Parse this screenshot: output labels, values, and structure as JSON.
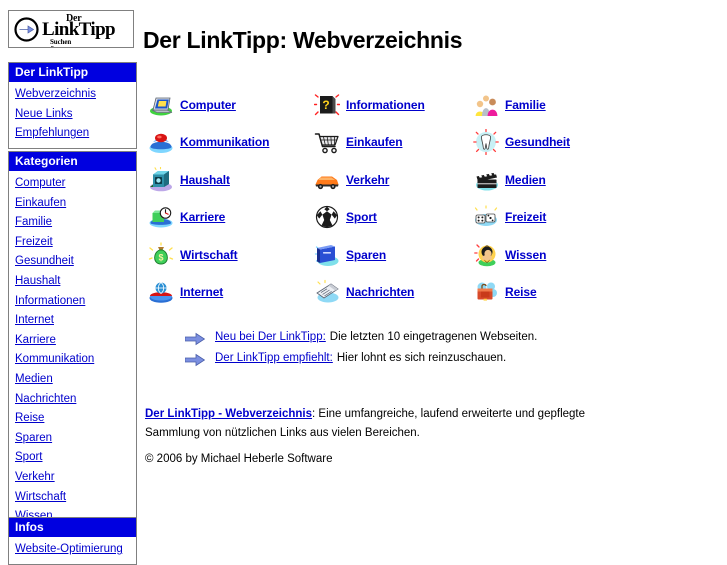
{
  "logo": {
    "der": "Der",
    "name": "LinkTipp",
    "tagline": "Suchen & Finden",
    "arrow_icon": "circle-arrow-right-icon"
  },
  "header": {
    "title": "Der LinkTipp: Webverzeichnis"
  },
  "colors": {
    "header_blue": "#0000e0",
    "link_blue": "#0000cc",
    "border_gray": "#808080",
    "background": "#ffffff"
  },
  "sidebar": {
    "boxes": [
      {
        "title": "Der LinkTipp",
        "items": [
          {
            "label": "Webverzeichnis"
          },
          {
            "label": "Neue Links"
          },
          {
            "label": "Empfehlungen"
          }
        ]
      },
      {
        "title": "Kategorien",
        "items": [
          {
            "label": "Computer"
          },
          {
            "label": "Einkaufen"
          },
          {
            "label": "Familie"
          },
          {
            "label": "Freizeit"
          },
          {
            "label": "Gesundheit"
          },
          {
            "label": "Haushalt"
          },
          {
            "label": "Informationen"
          },
          {
            "label": "Internet"
          },
          {
            "label": "Karriere"
          },
          {
            "label": "Kommunikation"
          },
          {
            "label": "Medien"
          },
          {
            "label": "Nachrichten"
          },
          {
            "label": "Reise"
          },
          {
            "label": "Sparen"
          },
          {
            "label": "Sport"
          },
          {
            "label": "Verkehr"
          },
          {
            "label": "Wirtschaft"
          },
          {
            "label": "Wissen"
          }
        ]
      },
      {
        "title": "Infos",
        "items": [
          {
            "label": "Website-Optimierung"
          }
        ]
      }
    ]
  },
  "main": {
    "categories": [
      {
        "label": "Computer",
        "icon": "laptop-icon"
      },
      {
        "label": "Informationen",
        "icon": "info-box-icon"
      },
      {
        "label": "Familie",
        "icon": "family-people-icon"
      },
      {
        "label": "Kommunikation",
        "icon": "telephone-icon"
      },
      {
        "label": "Einkaufen",
        "icon": "shopping-cart-icon"
      },
      {
        "label": "Gesundheit",
        "icon": "tooth-icon"
      },
      {
        "label": "Haushalt",
        "icon": "washing-machine-icon"
      },
      {
        "label": "Verkehr",
        "icon": "car-icon"
      },
      {
        "label": "Medien",
        "icon": "film-clapper-icon"
      },
      {
        "label": "Karriere",
        "icon": "briefcase-clock-icon"
      },
      {
        "label": "Sport",
        "icon": "soccer-ball-icon"
      },
      {
        "label": "Freizeit",
        "icon": "dice-icon"
      },
      {
        "label": "Wirtschaft",
        "icon": "money-bag-icon"
      },
      {
        "label": "Sparen",
        "icon": "piggy-safe-icon"
      },
      {
        "label": "Wissen",
        "icon": "head-globe-icon"
      },
      {
        "label": "Internet",
        "icon": "network-globe-icon"
      },
      {
        "label": "Nachrichten",
        "icon": "newspaper-icon"
      },
      {
        "label": "Reise",
        "icon": "suitcase-icon"
      }
    ],
    "arrow_links": [
      {
        "icon": "arrow-right-icon",
        "link": "Neu bei Der LinkTipp:",
        "text": "Die letzten 10 eingetragenen Webseiten."
      },
      {
        "icon": "arrow-right-icon",
        "link": "Der LinkTipp empfiehlt:",
        "text": "Hier lohnt es sich reinzuschauen."
      }
    ],
    "footer": {
      "link": "Der LinkTipp - Webverzeichnis",
      "text": ": Eine umfangreiche, laufend erweiterte und gepflegte Sammlung von nützlichen Links aus vielen Bereichen.",
      "copyright": "© 2006 by Michael Heberle Software"
    }
  }
}
